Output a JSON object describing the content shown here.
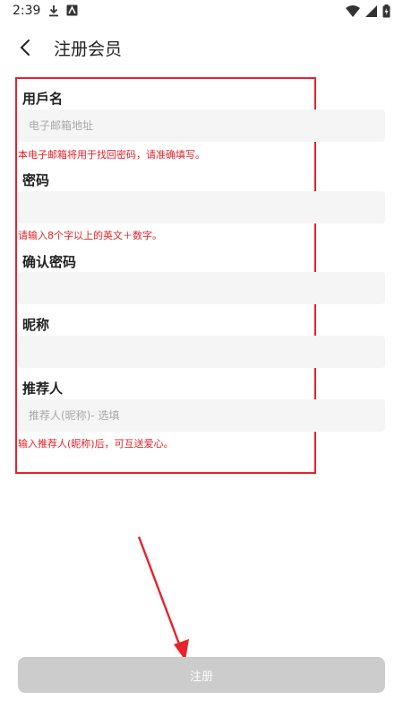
{
  "status_bar": {
    "time": "2:39",
    "icons_left": [
      "download-icon",
      "app-notification-icon"
    ],
    "icons_right": [
      "wifi-icon",
      "signal-icon",
      "battery-icon"
    ]
  },
  "header": {
    "title": "注册会员",
    "back_icon": "chevron-left-icon"
  },
  "form": {
    "username": {
      "label": "用戶名",
      "value": "",
      "placeholder": "电子邮箱地址",
      "hint": "本电子邮箱将用于找回密码，请准确填写。"
    },
    "password": {
      "label": "密码",
      "value": "",
      "placeholder": "",
      "hint": "请输入8个字以上的英文＋数字。"
    },
    "confirm_password": {
      "label": "确认密码",
      "value": "",
      "placeholder": ""
    },
    "nickname": {
      "label": "昵称",
      "value": "",
      "placeholder": ""
    },
    "referrer": {
      "label": "推荐人",
      "value": "",
      "placeholder": "推荐人(昵称)- 选填",
      "hint": "输入推荐人(昵称)后，可互送爱心。"
    }
  },
  "submit": {
    "label": "注册"
  },
  "colors": {
    "annotation_red": "#e8222a",
    "button_disabled": "#cccccc",
    "input_bg": "#f5f5f5"
  }
}
